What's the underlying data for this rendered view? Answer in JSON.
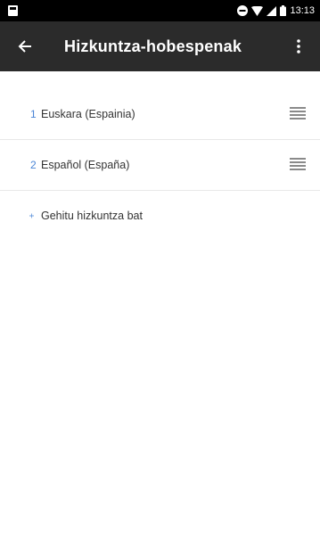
{
  "status_bar": {
    "time": "13:13"
  },
  "app_bar": {
    "title": "Hizkuntza-hobespenak",
    "back_icon": "arrow-back-icon",
    "overflow_icon": "more-vert-icon"
  },
  "languages": [
    {
      "index": "1",
      "label": "Euskara (Espainia)"
    },
    {
      "index": "2",
      "label": "Español (España)"
    }
  ],
  "add_language": {
    "label": "Gehitu hizkuntza bat",
    "icon": "plus-icon"
  },
  "colors": {
    "app_bar": "#2b2b2b",
    "accent": "#4a85d6",
    "status_bar": "#000000"
  }
}
